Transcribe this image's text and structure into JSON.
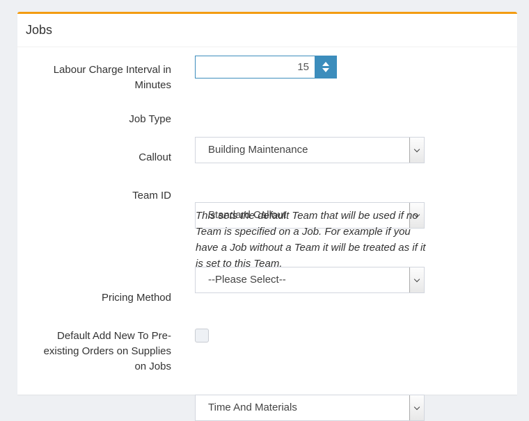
{
  "panel": {
    "title": "Jobs",
    "accent_color": "#f39c12"
  },
  "fields": {
    "labour_charge": {
      "label_line1": "Labour Charge Interval in",
      "label_line2": "Minutes",
      "value": "15"
    },
    "job_type": {
      "label": "Job Type",
      "value": "Building Maintenance"
    },
    "callout": {
      "label": "Callout",
      "value": "Standard Callout"
    },
    "team_id": {
      "label": "Team ID",
      "value": "--Please Select--",
      "help_text": "This sets the default Team that will be used if no Team is specified on a Job. For example if you have a Job without a Team it will be treated as if it is set to this Team."
    },
    "pricing_method": {
      "label": "Pricing Method",
      "value": "Time And Materials"
    },
    "default_add_new": {
      "label_line1": "Default Add New To Pre-",
      "label_line2": "existing Orders on Supplies",
      "label_line3": "on Jobs",
      "checked": false
    }
  },
  "icons": {
    "spinner": "spinner-arrows-icon",
    "dropdown": "chevron-down-icon"
  }
}
